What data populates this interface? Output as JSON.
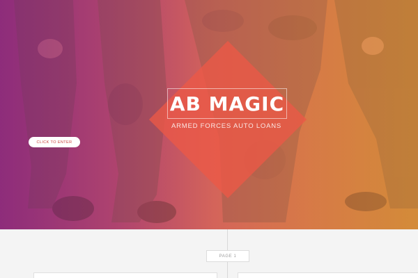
{
  "hero": {
    "title": "AB MAGIC",
    "subtitle": "ARMED FORCES AUTO LOANS",
    "cta_label": "CLICK TO ENTER"
  },
  "timeline": {
    "page_label": "PAGE 1"
  },
  "colors": {
    "gradient_start": "#8a2c78",
    "gradient_mid": "#d8675a",
    "gradient_end": "#cc8a36",
    "diamond": "#ec5846",
    "cta_text": "#c9403a"
  }
}
